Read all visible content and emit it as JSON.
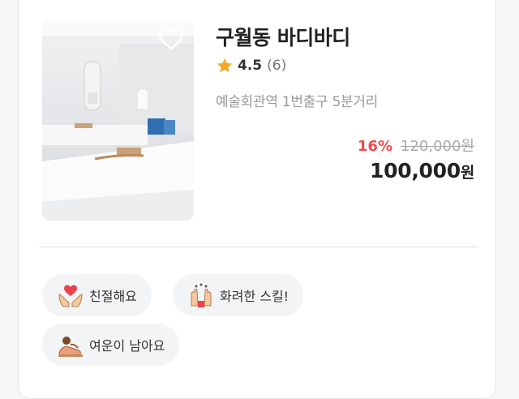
{
  "listing": {
    "name": "구월동 바디바디",
    "rating": "4.5",
    "review_count": "(6)",
    "location": "예술회관역 1번출구 5분거리",
    "discount_percent": "16%",
    "original_price": "120,000원",
    "price": "100,000",
    "price_unit": "원"
  },
  "tags": [
    {
      "label": "친절해요",
      "icon": "heart-hands-icon"
    },
    {
      "label": "화려한 스킬!",
      "icon": "clapping-hands-icon"
    },
    {
      "label": "여운이 남아요",
      "icon": "massage-person-icon"
    }
  ],
  "colors": {
    "discount": "#ef4b4b",
    "star": "#f5a623",
    "chip_bg": "#f3f4f6"
  }
}
